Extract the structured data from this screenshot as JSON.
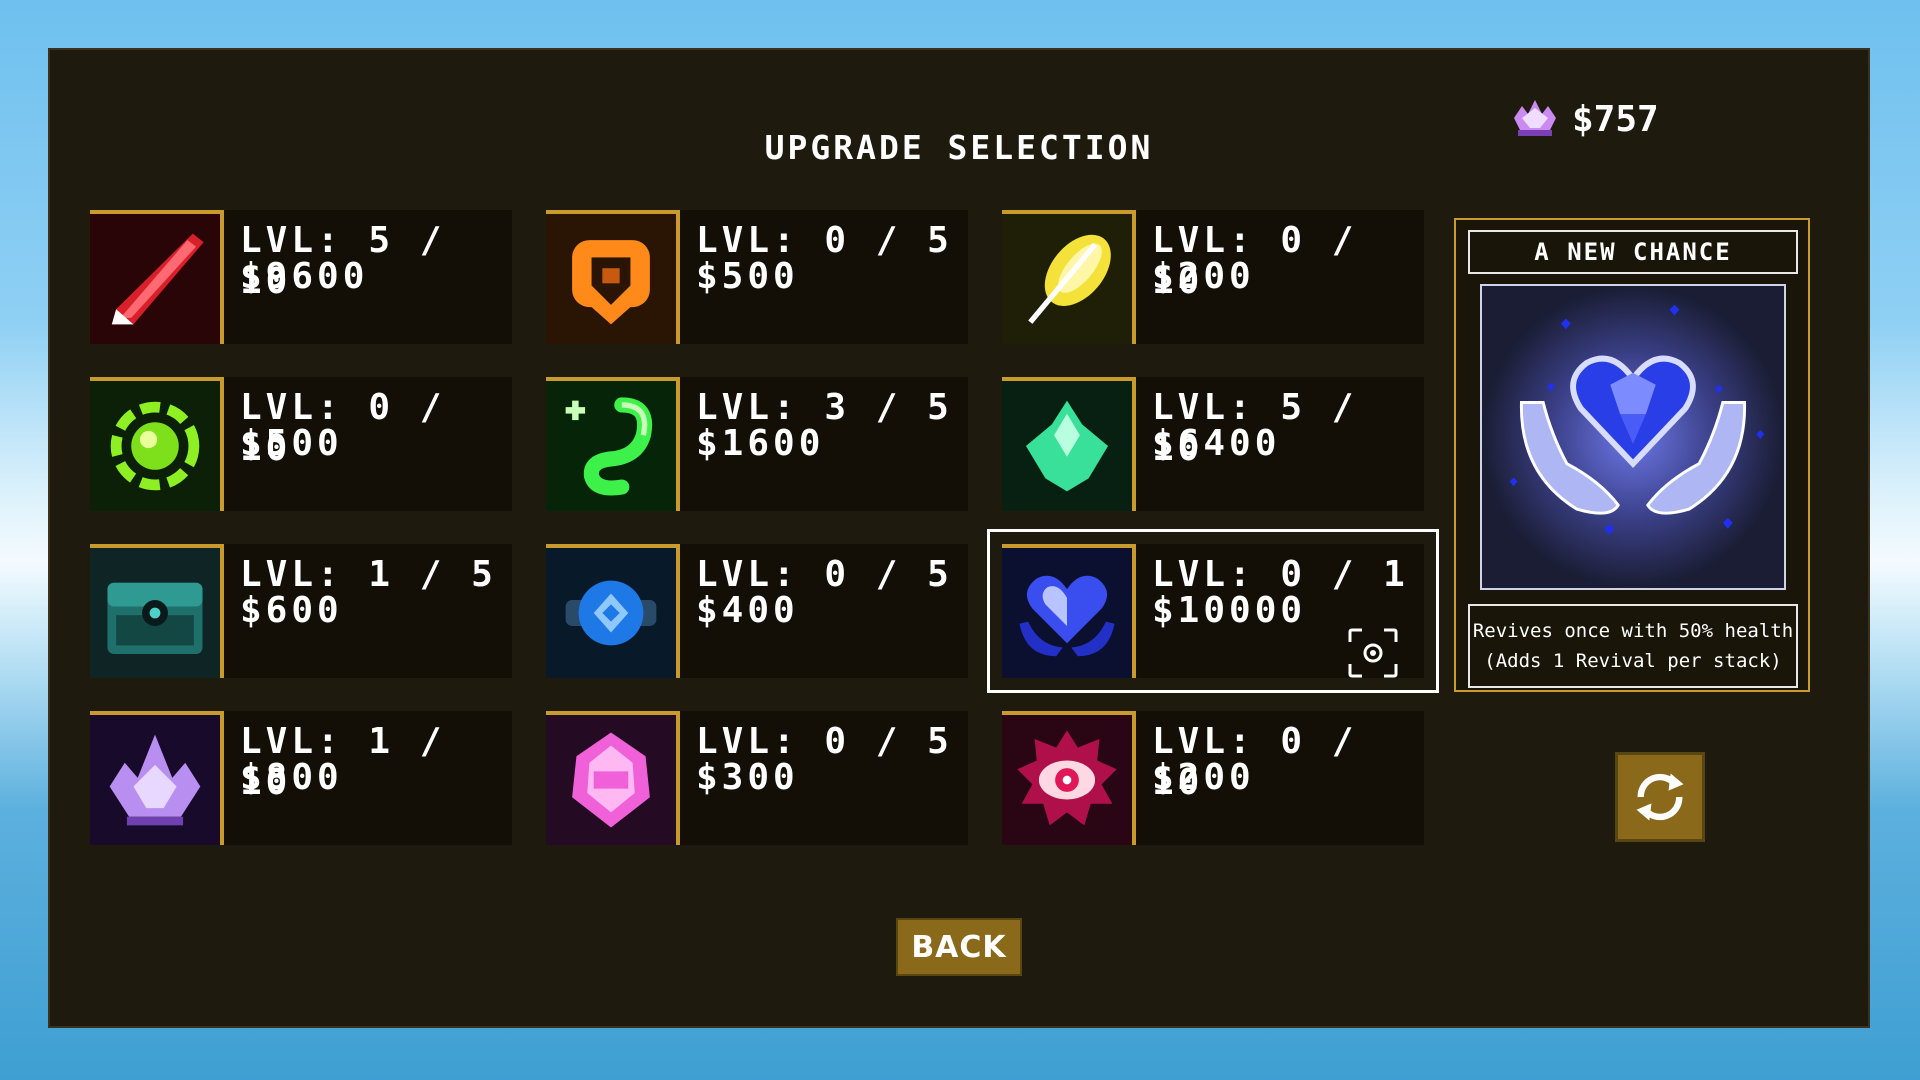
{
  "screen": {
    "title": "UPGRADE SELECTION",
    "currency": "$757",
    "back_label": "BACK"
  },
  "upgrades": [
    {
      "icon": "red-blade-icon",
      "level": "LVL: 5 / 10",
      "price": "$9600"
    },
    {
      "icon": "orange-shield-icon",
      "level": "LVL: 0 / 5",
      "price": "$500"
    },
    {
      "icon": "golden-feather-icon",
      "level": "LVL: 0 / 10",
      "price": "$200"
    },
    {
      "icon": "green-orb-icon",
      "level": "LVL: 0 / 10",
      "price": "$500"
    },
    {
      "icon": "green-serpent-icon",
      "level": "LVL: 3 / 5",
      "price": "$1600"
    },
    {
      "icon": "mint-crystal-icon",
      "level": "LVL: 5 / 10",
      "price": "$6400"
    },
    {
      "icon": "teal-chest-icon",
      "level": "LVL: 1 / 5",
      "price": "$600"
    },
    {
      "icon": "blue-orb-icon",
      "level": "LVL: 0 / 5",
      "price": "$400"
    },
    {
      "icon": "blue-heart-hands-icon",
      "level": "LVL: 0 / 1",
      "price": "$10000"
    },
    {
      "icon": "purple-crystal-icon",
      "level": "LVL: 1 / 10",
      "price": "$800"
    },
    {
      "icon": "pink-gem-icon",
      "level": "LVL: 0 / 5",
      "price": "$300"
    },
    {
      "icon": "crimson-eye-icon",
      "level": "LVL: 0 / 10",
      "price": "$200"
    }
  ],
  "detail": {
    "name": "A NEW CHANCE",
    "description_line1": "Revives once with 50% health",
    "description_line2": "(Adds 1 Revival per stack)"
  },
  "colors": {
    "panel": "#1f1a0e",
    "card": "#130f07",
    "accent": "#c99a2c",
    "button": "#8a6a1a"
  }
}
